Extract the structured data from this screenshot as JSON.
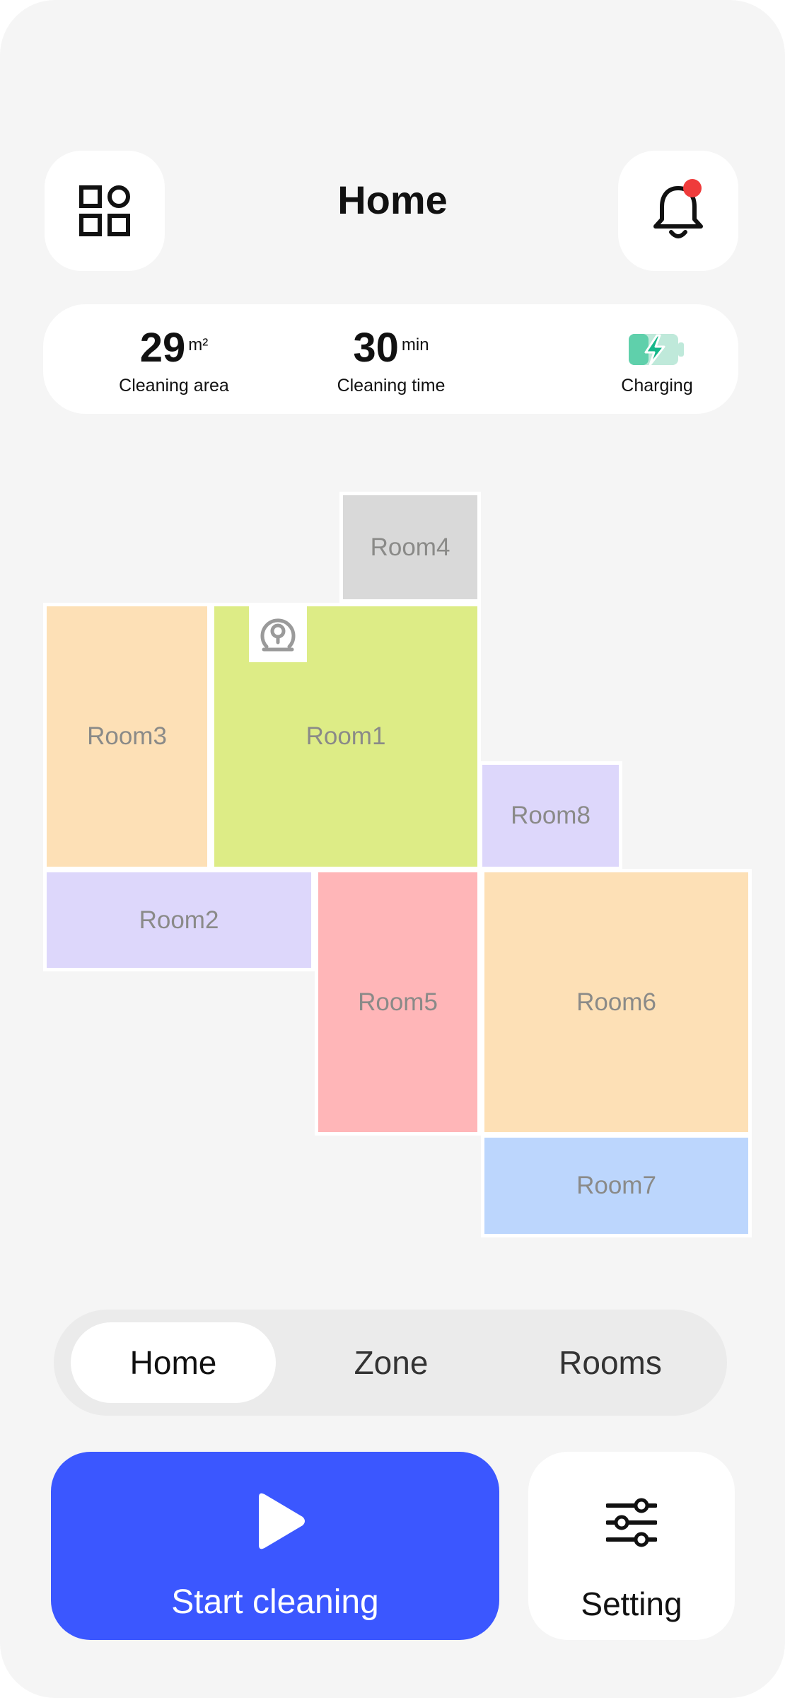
{
  "header": {
    "title": "Home",
    "menu_icon": "grid-icon",
    "notification_icon": "bell-icon",
    "notification_dot_color": "#ef3b3b"
  },
  "stats": {
    "area": {
      "value": "29",
      "unit": "m²",
      "label": "Cleaning area"
    },
    "time": {
      "value": "30",
      "unit": "min",
      "label": "Cleaning time"
    },
    "battery": {
      "label": "Charging",
      "icon": "battery-charging-icon",
      "color": "#16b78a"
    }
  },
  "map": {
    "rooms": [
      {
        "id": "room4",
        "label": "Room4",
        "color": "#d9d9d9"
      },
      {
        "id": "room3",
        "label": "Room3",
        "color": "#fde0b6"
      },
      {
        "id": "room1",
        "label": "Room1",
        "color": "#ddec86"
      },
      {
        "id": "room8",
        "label": "Room8",
        "color": "#ddd7fb"
      },
      {
        "id": "room2",
        "label": "Room2",
        "color": "#ddd7fb"
      },
      {
        "id": "room5",
        "label": "Room5",
        "color": "#ffb6b8"
      },
      {
        "id": "room6",
        "label": "Room6",
        "color": "#fde0b6"
      },
      {
        "id": "room7",
        "label": "Room7",
        "color": "#bcd6fd"
      }
    ],
    "robot_icon": "robot-vacuum-icon"
  },
  "tabs": [
    {
      "label": "Home",
      "active": true
    },
    {
      "label": "Zone",
      "active": false
    },
    {
      "label": "Rooms",
      "active": false
    }
  ],
  "actions": {
    "start_label": "Start cleaning",
    "start_icon": "play-icon",
    "start_color": "#3b57ff",
    "setting_label": "Setting",
    "setting_icon": "sliders-icon"
  }
}
